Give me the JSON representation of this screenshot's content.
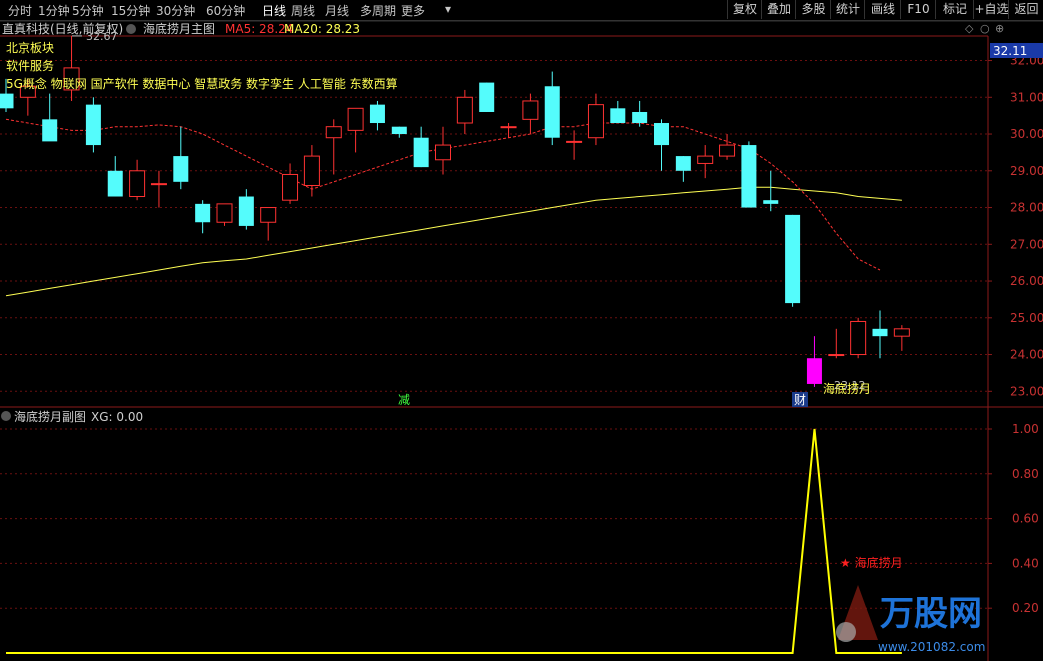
{
  "toolbar": {
    "periods": [
      "分时",
      "1分钟",
      "5分钟",
      "15分钟",
      "30分钟",
      "60分钟",
      "日线",
      "周线",
      "月线",
      "多周期",
      "更多"
    ],
    "active_period": "日线",
    "more_arrow": "▾",
    "right_buttons": [
      "复权",
      "叠加",
      "多股",
      "统计",
      "画线",
      "F10",
      "标记",
      "+自选",
      "返回"
    ]
  },
  "main_panel": {
    "stock_title": "直真科技(日线,前复权)",
    "indicator_name": "海底捞月主图",
    "ma5_label": "MA5: 28.24",
    "ma20_label": "MA20: 28.23",
    "concept_lines": [
      "北京板块",
      "软件服务",
      "5G概念 物联网 国产软件 数据中心 智慧政务 数字孪生 人工智能 东数西算"
    ],
    "high_marker": "32.67",
    "low_marker": "23.12",
    "signal_label": "海底捞月",
    "event_marks": [
      "减",
      "财"
    ],
    "price_tag": "32.11",
    "colors": {
      "up": "#ff3232",
      "down": "#54fcfc",
      "ma5": "#ff3232",
      "ma20": "#ffff54",
      "signal_bar": "#ff00ff",
      "label": "#ffff54"
    }
  },
  "sub_panel": {
    "indicator_name": "海底捞月副图",
    "xg_label": "XG: 0.00",
    "star_label": "★ 海底捞月",
    "colors": {
      "line": "#ffff00",
      "star": "#ff2020"
    }
  },
  "watermark": {
    "brand": "万股网",
    "url": "www.201082.com"
  },
  "chart_data": [
    {
      "type": "candlestick",
      "title": "海底捞月主图",
      "ylim": [
        22.6,
        32.45
      ],
      "yticks": [
        23.0,
        24.0,
        25.0,
        26.0,
        27.0,
        28.0,
        29.0,
        30.0,
        31.0,
        32.0
      ],
      "ytick_labels": [
        "23.00",
        "24.00",
        "25.00",
        "26.00",
        "27.00",
        "28.00",
        "29.00",
        "30.00",
        "31.00",
        "32.00"
      ],
      "candles": [
        {
          "o": 31.1,
          "h": 31.5,
          "l": 30.6,
          "c": 30.7
        },
        {
          "o": 31.0,
          "h": 31.5,
          "l": 30.5,
          "c": 31.3
        },
        {
          "o": 30.4,
          "h": 31.1,
          "l": 29.9,
          "c": 29.8
        },
        {
          "o": 31.2,
          "h": 32.67,
          "l": 30.9,
          "c": 31.8
        },
        {
          "o": 30.8,
          "h": 31.0,
          "l": 29.5,
          "c": 29.7
        },
        {
          "o": 29.0,
          "h": 29.4,
          "l": 28.3,
          "c": 28.3
        },
        {
          "o": 28.3,
          "h": 29.3,
          "l": 28.2,
          "c": 29.0
        },
        {
          "o": 28.65,
          "h": 29.0,
          "l": 28.0,
          "c": 28.65
        },
        {
          "o": 29.4,
          "h": 30.2,
          "l": 28.5,
          "c": 28.7
        },
        {
          "o": 28.1,
          "h": 28.2,
          "l": 27.3,
          "c": 27.6
        },
        {
          "o": 27.6,
          "h": 28.1,
          "l": 27.5,
          "c": 28.1
        },
        {
          "o": 28.3,
          "h": 28.5,
          "l": 27.4,
          "c": 27.5
        },
        {
          "o": 27.6,
          "h": 28.0,
          "l": 27.1,
          "c": 28.0
        },
        {
          "o": 28.2,
          "h": 29.2,
          "l": 28.1,
          "c": 28.9
        },
        {
          "o": 28.6,
          "h": 29.7,
          "l": 28.3,
          "c": 29.4
        },
        {
          "o": 29.9,
          "h": 30.4,
          "l": 28.9,
          "c": 30.2
        },
        {
          "o": 30.1,
          "h": 30.6,
          "l": 29.5,
          "c": 30.7
        },
        {
          "o": 30.8,
          "h": 30.9,
          "l": 30.1,
          "c": 30.3
        },
        {
          "o": 30.2,
          "h": 30.2,
          "l": 29.9,
          "c": 30.0
        },
        {
          "o": 29.9,
          "h": 30.2,
          "l": 29.1,
          "c": 29.1
        },
        {
          "o": 29.3,
          "h": 30.2,
          "l": 28.9,
          "c": 29.7
        },
        {
          "o": 30.3,
          "h": 31.2,
          "l": 30.0,
          "c": 31.0
        },
        {
          "o": 31.4,
          "h": 31.4,
          "l": 30.6,
          "c": 30.6
        },
        {
          "o": 30.2,
          "h": 30.3,
          "l": 29.9,
          "c": 30.2
        },
        {
          "o": 30.4,
          "h": 31.1,
          "l": 30.0,
          "c": 30.9
        },
        {
          "o": 31.3,
          "h": 31.7,
          "l": 29.7,
          "c": 29.9
        },
        {
          "o": 29.8,
          "h": 30.1,
          "l": 29.3,
          "c": 29.8
        },
        {
          "o": 29.9,
          "h": 31.1,
          "l": 29.7,
          "c": 30.8
        },
        {
          "o": 30.7,
          "h": 30.9,
          "l": 30.3,
          "c": 30.3
        },
        {
          "o": 30.6,
          "h": 30.9,
          "l": 30.2,
          "c": 30.3
        },
        {
          "o": 30.3,
          "h": 30.4,
          "l": 29.0,
          "c": 29.7
        },
        {
          "o": 29.4,
          "h": 29.4,
          "l": 28.7,
          "c": 29.0
        },
        {
          "o": 29.2,
          "h": 29.7,
          "l": 28.8,
          "c": 29.4
        },
        {
          "o": 29.4,
          "h": 30.0,
          "l": 29.3,
          "c": 29.7
        },
        {
          "o": 29.7,
          "h": 29.8,
          "l": 28.0,
          "c": 28.0
        },
        {
          "o": 28.2,
          "h": 29.0,
          "l": 27.9,
          "c": 28.1
        },
        {
          "o": 27.8,
          "h": 27.8,
          "l": 25.3,
          "c": 25.4
        },
        {
          "o": 23.2,
          "h": 24.5,
          "l": 23.12,
          "c": 23.9
        },
        {
          "o": 24.0,
          "h": 24.7,
          "l": 23.9,
          "c": 24.0
        },
        {
          "o": 24.0,
          "h": 25.0,
          "l": 23.9,
          "c": 24.9
        },
        {
          "o": 24.7,
          "h": 25.2,
          "l": 23.9,
          "c": 24.5
        },
        {
          "o": 24.5,
          "h": 24.8,
          "l": 24.1,
          "c": 24.7
        }
      ],
      "ma5": [
        30.4,
        30.3,
        30.2,
        30.1,
        30.1,
        30.2,
        30.2,
        30.25,
        30.2,
        30.0,
        29.7,
        29.4,
        29.1,
        28.8,
        28.5,
        28.7,
        28.9,
        29.1,
        29.3,
        29.5,
        29.6,
        29.7,
        29.8,
        29.9,
        30.0,
        30.2,
        30.2,
        30.3,
        30.3,
        30.3,
        30.2,
        30.2,
        30.0,
        29.8,
        29.6,
        29.2,
        28.7,
        28.1,
        27.3,
        26.6,
        26.3
      ],
      "ma20": [
        25.6,
        25.7,
        25.8,
        25.9,
        26.0,
        26.1,
        26.2,
        26.3,
        26.4,
        26.5,
        26.55,
        26.6,
        26.7,
        26.8,
        26.9,
        27.0,
        27.1,
        27.2,
        27.3,
        27.4,
        27.5,
        27.6,
        27.7,
        27.8,
        27.9,
        28.0,
        28.1,
        28.2,
        28.25,
        28.3,
        28.35,
        28.4,
        28.45,
        28.5,
        28.55,
        28.55,
        28.5,
        28.45,
        28.4,
        28.3,
        28.25,
        28.2
      ]
    },
    {
      "type": "line",
      "title": "海底捞月副图",
      "series": [
        {
          "values": [
            0,
            0,
            0,
            0,
            0,
            0,
            0,
            0,
            0,
            0,
            0,
            0,
            0,
            0,
            0,
            0,
            0,
            0,
            0,
            0,
            0,
            0,
            0,
            0,
            0,
            0,
            0,
            0,
            0,
            0,
            0,
            0,
            0,
            0,
            0,
            0,
            0,
            1,
            0,
            0,
            0,
            0
          ]
        }
      ],
      "ylim": [
        0,
        1.0
      ],
      "yticks": [
        0.2,
        0.4,
        0.6,
        0.8,
        1.0
      ],
      "ytick_labels": [
        "0.20",
        "0.40",
        "0.60",
        "0.80",
        "1.00"
      ]
    }
  ]
}
